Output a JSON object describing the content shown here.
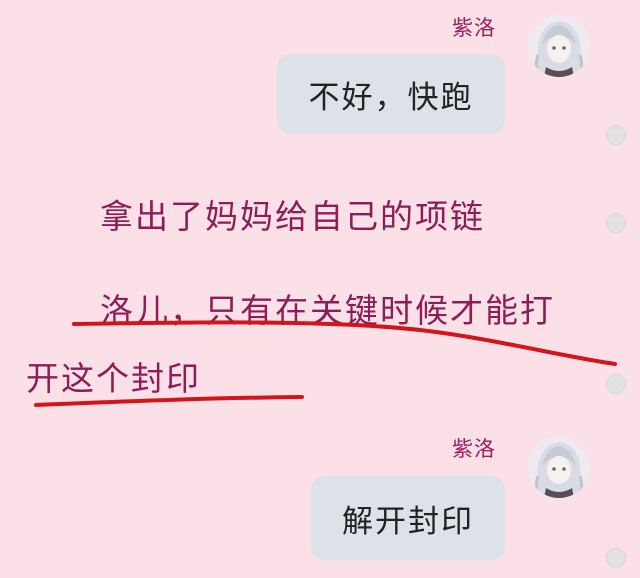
{
  "messages": [
    {
      "sender": "紫洛",
      "text": "不好，快跑",
      "avatar": "character-avatar-icon"
    },
    {
      "sender": "紫洛",
      "text": "解开封印",
      "avatar": "character-avatar-icon"
    }
  ],
  "narration": {
    "line1": "拿出了妈妈给自己的项链",
    "line2": "洛儿，只有在关键时候才能打",
    "line3": "开这个封印"
  },
  "colors": {
    "background": "#fbe0e8",
    "bubble": "#dde1e8",
    "name_text": "#9a1f5e",
    "narration_text": "#8c1d55",
    "underline": "#d3141c"
  }
}
